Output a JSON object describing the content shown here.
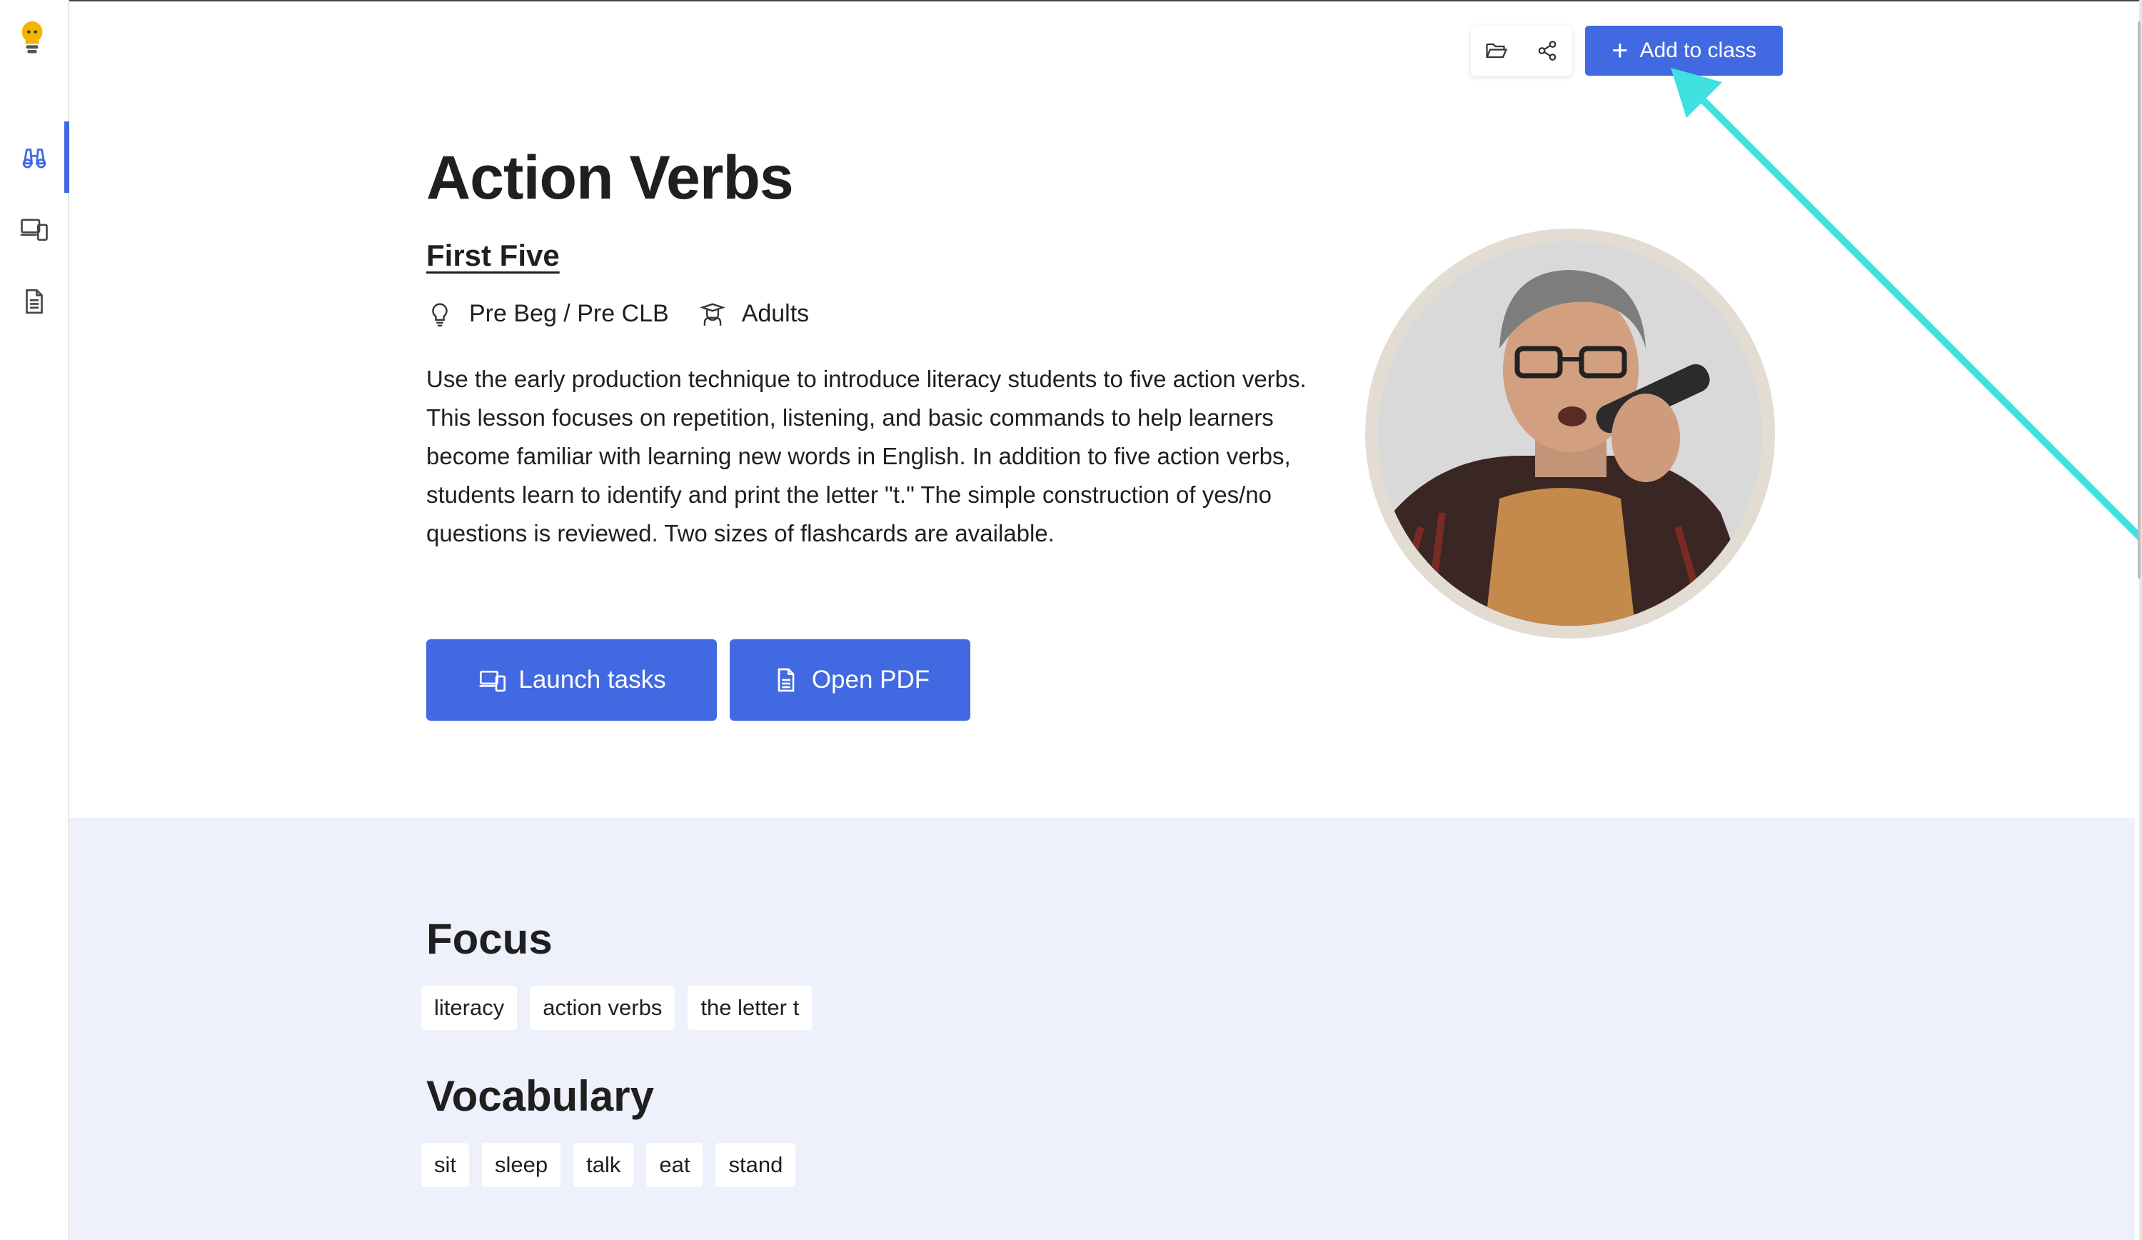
{
  "toolbar": {
    "folder_icon": "folder-open-icon",
    "share_icon": "share-icon",
    "add_to_class_label": "Add to class",
    "add_icon": "plus-icon"
  },
  "sidebar": {
    "logo_icon": "lightbulb-logo-icon",
    "items": [
      {
        "icon": "binoculars-icon",
        "active": true
      },
      {
        "icon": "devices-icon",
        "active": false
      },
      {
        "icon": "document-icon",
        "active": false
      }
    ]
  },
  "lesson": {
    "title": "Action Verbs",
    "subtitle": "First Five",
    "level": "Pre Beg / Pre CLB",
    "audience": "Adults",
    "description": "Use the early production technique to introduce literacy students to five action verbs. This lesson focuses on repetition, listening, and basic commands to help learners become familiar with learning new words in English. In addition to five action verbs, students learn to identify and print the letter \"t.\" The simple construction of yes/no questions is reviewed. Two sizes of flashcards are available.",
    "launch_label": "Launch tasks",
    "pdf_label": "Open PDF"
  },
  "focus": {
    "heading": "Focus",
    "tags": [
      "literacy",
      "action verbs",
      "the letter t"
    ]
  },
  "vocabulary": {
    "heading": "Vocabulary",
    "tags": [
      "sit",
      "sleep",
      "talk",
      "eat",
      "stand"
    ]
  },
  "colors": {
    "accent": "#4169e1",
    "annotation_arrow": "#3fe0e0",
    "lower_bg": "#eef1fc"
  }
}
